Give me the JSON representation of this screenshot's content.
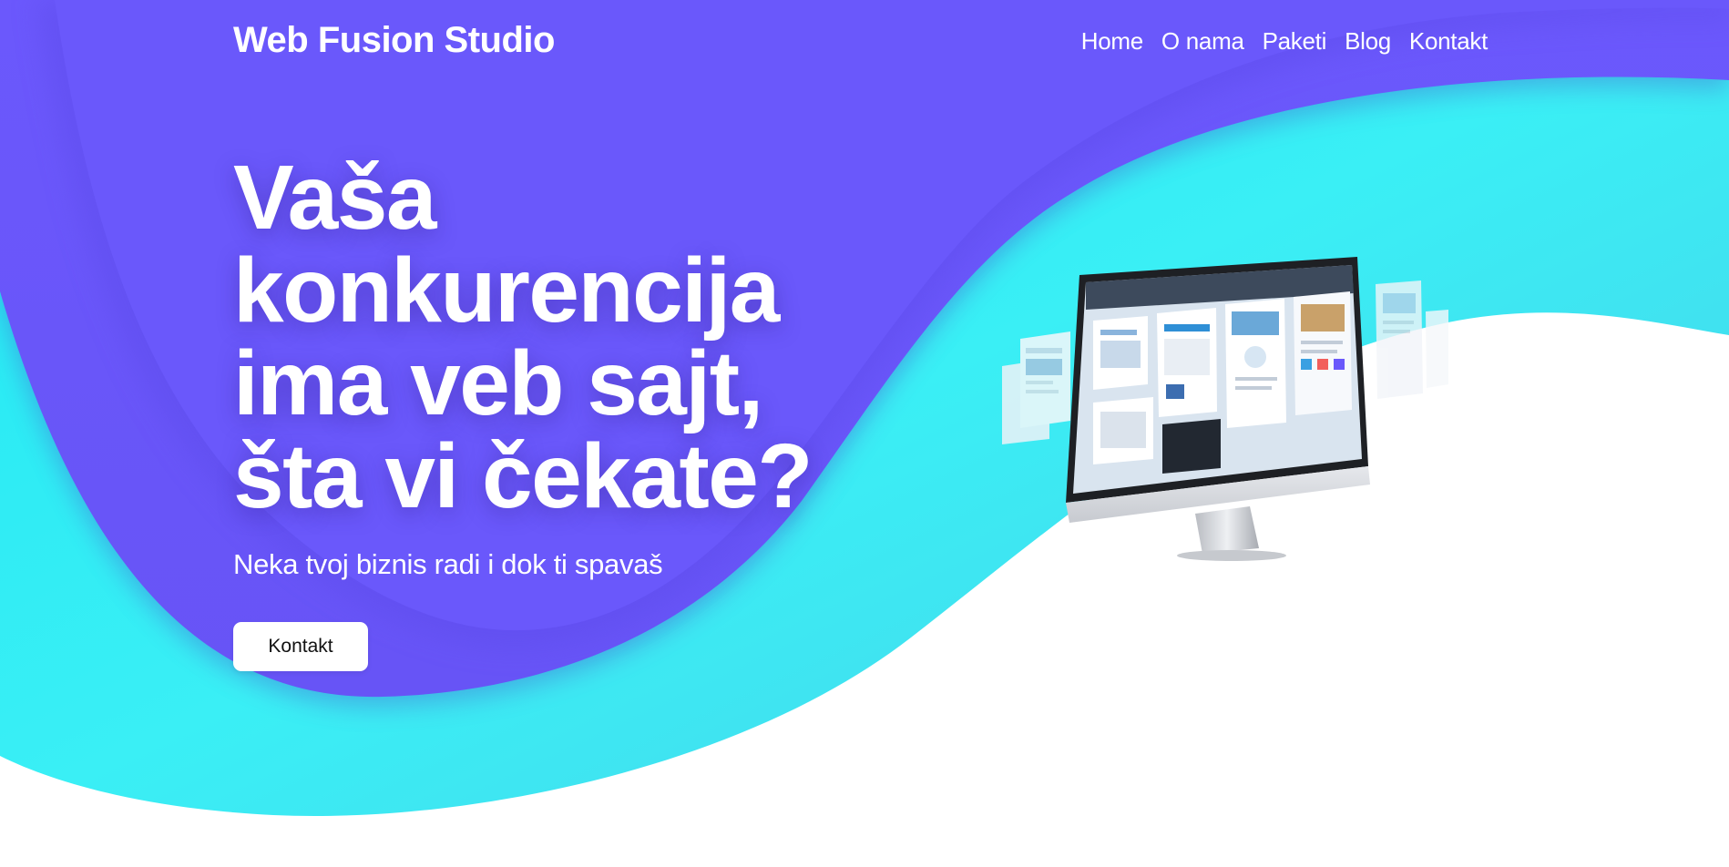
{
  "header": {
    "brand": "Web Fusion Studio",
    "nav": [
      "Home",
      "O nama",
      "Paketi",
      "Blog",
      "Kontakt"
    ]
  },
  "hero": {
    "title_lines": [
      "Vaša",
      "konkurencija",
      "ima veb sajt,",
      "šta vi čekate?"
    ],
    "subtitle": "Neka tvoj biznis radi i dok ti spavaš",
    "cta_label": "Kontakt"
  },
  "illustration": {
    "icon": "monitor-with-website-mockups"
  },
  "colors": {
    "purple": "#6a58fb",
    "cyan": "#19e9f2",
    "white": "#ffffff"
  }
}
